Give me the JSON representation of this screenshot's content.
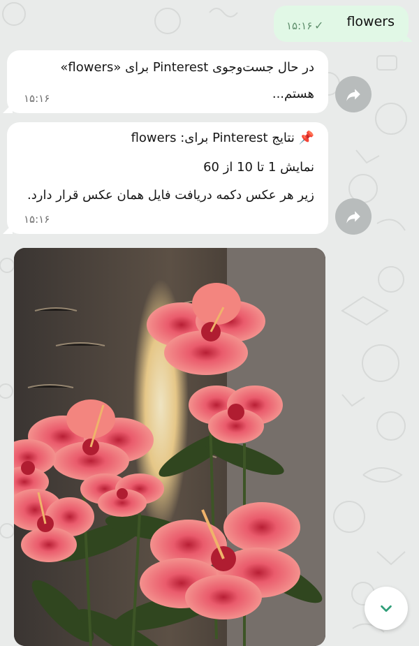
{
  "messages": {
    "outgoing": {
      "text": "flowers",
      "time": "۱۵:۱۶"
    },
    "incoming_1": {
      "line1": "در حال جست‌وجوی Pinterest برای «flowers»",
      "line2": "هستم...",
      "time": "۱۵:۱۶"
    },
    "incoming_2": {
      "line1": "📌 نتایج Pinterest برای: flowers",
      "line2": "نمایش 1 تا 10 از 60",
      "line3": "زیر هر عکس دکمه دریافت فایل همان عکس قرار دارد.",
      "time": "۱۵:۱۶"
    }
  },
  "icons": {
    "read_receipt": "check-icon",
    "share": "share-icon",
    "scroll": "chevron-down-icon"
  },
  "colors": {
    "outgoing_bubble": "#e1f8e6",
    "incoming_bubble": "#ffffff",
    "chat_background": "#e9ebea",
    "scroll_chevron": "#2f9e78"
  }
}
